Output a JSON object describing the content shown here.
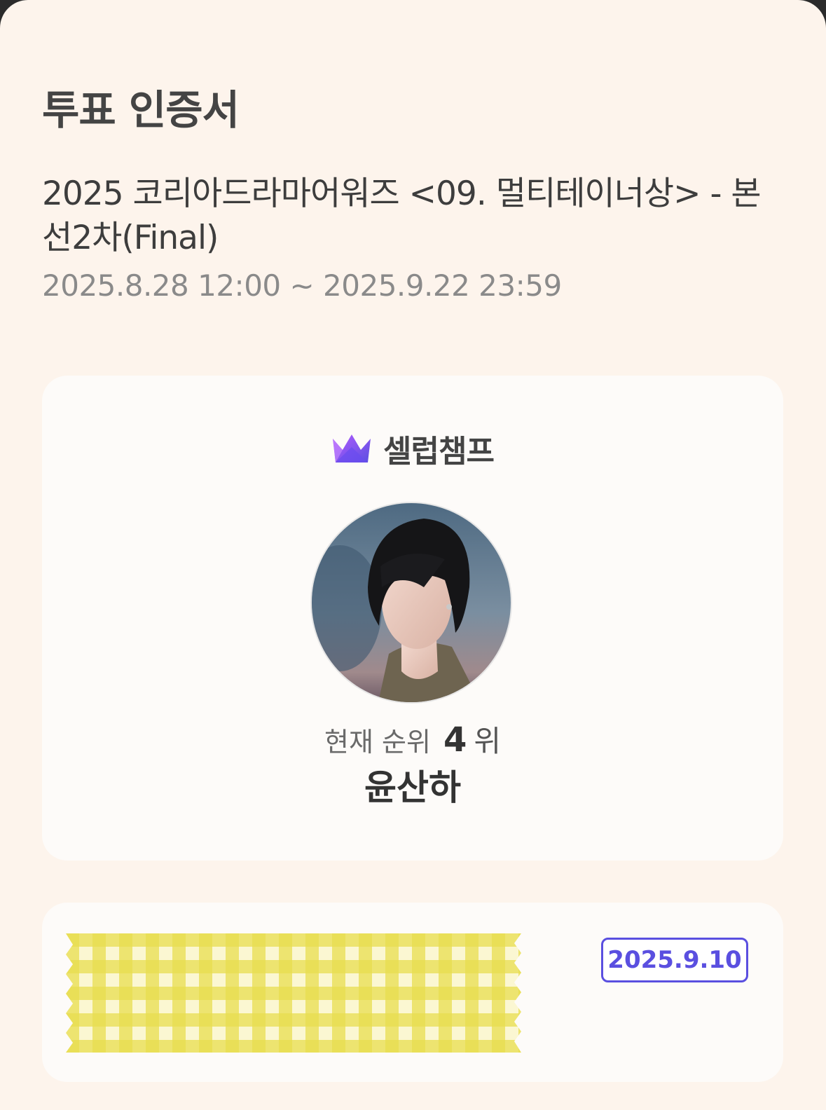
{
  "header": {
    "title": "투표 인증서"
  },
  "event": {
    "title": "2025 코리아드라마어워즈 <09. 멀티테이너상> - 본선2차(Final)",
    "period": "2025.8.28 12:00 ~ 2025.9.22 23:59"
  },
  "card": {
    "brand": {
      "name": "셀럽챔프",
      "icon": "crown-icon",
      "colors": [
        "#7b4dff",
        "#b45cff",
        "#5a4fe0"
      ]
    },
    "avatar": {
      "icon": "celebrity-photo"
    },
    "rank": {
      "label": "현재 순위",
      "value": "4",
      "unit": "위"
    },
    "celebrity_name": "윤산하"
  },
  "ticket": {
    "date": "2025.9.10",
    "accent_color": "#5a4fe0",
    "tape_color": "#e3d93a"
  }
}
